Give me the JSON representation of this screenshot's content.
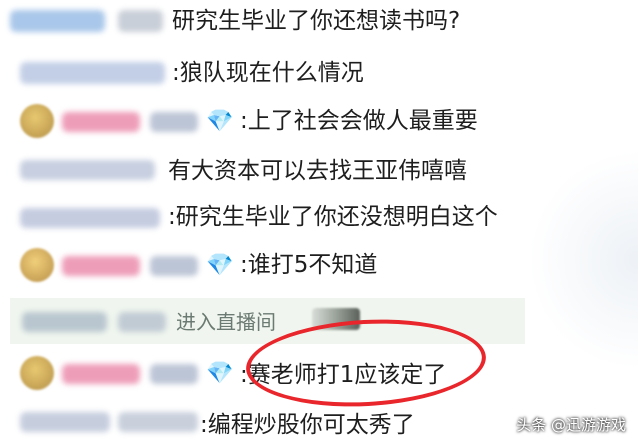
{
  "chat": {
    "messages": [
      {
        "text": "研究生毕业了你还想读书吗?"
      },
      {
        "text": "狼队现在什么情况"
      },
      {
        "text": "上了社会会做人最重要"
      },
      {
        "text": "有大资本可以去找王亚伟嘻嘻"
      },
      {
        "text": "研究生毕业了你还没想明白这个"
      },
      {
        "text": "谁打5不知道"
      },
      {
        "text": "赛老师打1应该定了"
      },
      {
        "text": "编程炒股你可太秀了"
      }
    ],
    "enter_notice": "进入直播间",
    "colon": ":",
    "gem_icon": "diamond-icon"
  },
  "watermark": "头条 @迅游游戏",
  "colors": {
    "highlight_circle": "#e8262b",
    "gem": "#e8739e",
    "enter_bg": "#f0f6ef"
  }
}
